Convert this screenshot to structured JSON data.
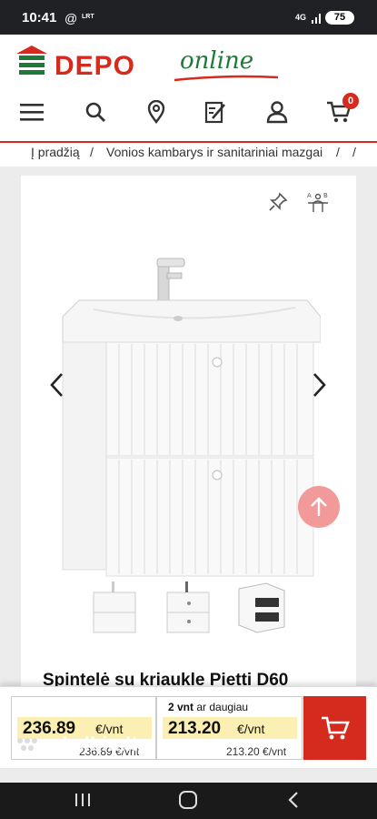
{
  "status": {
    "time": "10:41",
    "carrier": "LRT",
    "network": "4G",
    "battery": "75"
  },
  "brand": {
    "name": "DEPO",
    "suffix": "online",
    "accent": "#d52b1e",
    "green": "#1f7a3a"
  },
  "nav_icons": [
    "menu-icon",
    "search-icon",
    "location-icon",
    "edit-list-icon",
    "user-icon",
    "cart-icon"
  ],
  "cart": {
    "count": "0"
  },
  "breadcrumb": {
    "items": [
      "Į pradžią",
      "Vonios kambarys ir sanitariniai mazgai"
    ],
    "sep": "/"
  },
  "product": {
    "title_partial": "Spintelė su kriaukle Pietti D60",
    "thumbnails": 3
  },
  "price": {
    "single": {
      "value": "236.89",
      "unit": "€/vnt",
      "sub": "236.89 €/vnt"
    },
    "bulk": {
      "qty_bold": "2 vnt",
      "qty_text": " ar daugiau",
      "value": "213.20",
      "unit": "€/vnt",
      "sub": "213.20 €/vnt"
    }
  },
  "watermark": "skelbiu.lt"
}
